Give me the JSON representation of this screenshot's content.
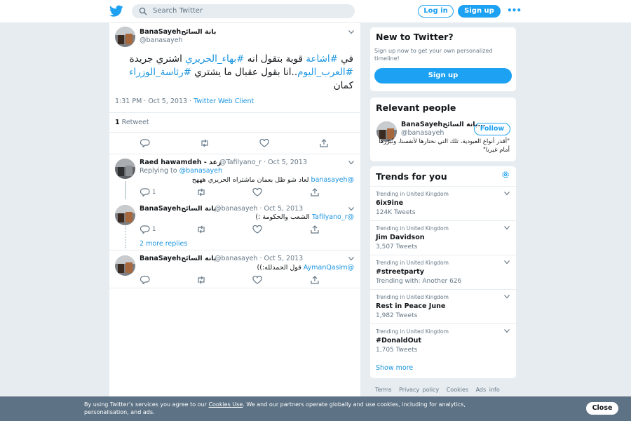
{
  "header": {
    "search_placeholder": "Search Twitter",
    "login_label": "Log in",
    "signup_label": "Sign up",
    "more_label": "•••",
    "brand_color": "#1da1f2"
  },
  "main_tweet": {
    "name": "BanaSayehبانة السائح",
    "handle": "@banasayeh",
    "text_parts": {
      "p1": "في ",
      "h1": "#اشاعة",
      "p2": " قوية بتقول انه ",
      "h2": "#بهاء_الحريري",
      "p3": " اشتري جريدة ",
      "h3": "#العرب_اليوم",
      "p4": "..انا بقول عقبال ما يشتري ",
      "h4": "#رئاسة_الوزراء",
      "p5": " كمان"
    },
    "time": "1:31 PM · Oct 5, 2013",
    "dot": " · ",
    "client": "Twitter Web Client",
    "retweet_count": "1",
    "retweet_label": "Retweet"
  },
  "replies": [
    {
      "name": "Raed hawamdeh - رعد",
      "handle": "@Tafilyano_r · Oct 5, 2013",
      "replying_prefix": "Replying to ",
      "replying_to": "@banasayeh",
      "mention": "@banasayeh",
      "text": " لعاد شو ظل بعمان ماشتراه الحريري هههخ",
      "reply_count": "1"
    },
    {
      "name": "BanaSayehبانة السائح",
      "handle": "@banasayeh · Oct 5, 2013",
      "mention": "@Tafilyano_r",
      "text": " الشعب والحكومة :)",
      "reply_count": "1"
    },
    {
      "more_replies": "2 more replies"
    },
    {
      "name": "BanaSayehبانة السائح",
      "handle": "@banasayeh · Oct 5, 2013",
      "mention": "@AymanQasim",
      "text": " قول الحمدلله:))"
    }
  ],
  "sidebar": {
    "new_to_twitter": {
      "title": "New to Twitter?",
      "subtitle": "Sign up now to get your own personalized timeline!",
      "signup_label": "Sign up"
    },
    "relevant_people": {
      "title": "Relevant people",
      "name": "BanaSayehبانة السائح...",
      "handle": "@banasayeh",
      "follow_label": "Follow",
      "bio": "\"أقذر أنواع العبودية، تلك التي نختارها لأنفسنا، ونُبرّرها أمام غيرنا\""
    },
    "trends": {
      "title": "Trends for you",
      "items": [
        {
          "context": "Trending in United Kingdom",
          "name": "6ix9ine",
          "count": "124K Tweets"
        },
        {
          "context": "Trending in United Kingdom",
          "name": "Jim Davidson",
          "count": "3,507 Tweets"
        },
        {
          "context": "Trending in United Kingdom",
          "name": "#streetparty",
          "count": "Trending with: Another 626"
        },
        {
          "context": "Trending in United Kingdom",
          "name": "Rest in Peace June",
          "count": "1,982 Tweets"
        },
        {
          "context": "Trending in United Kingdom",
          "name": "#DonaldOut",
          "count": "1,705 Tweets"
        }
      ],
      "show_more": "Show more"
    },
    "footer": [
      "Terms",
      "Privacy policy",
      "Cookies",
      "Ads info"
    ]
  },
  "cookie_bar": {
    "text_before": "By using Twitter’s services you agree to our ",
    "link": "Cookies Use",
    "text_after": ". We and our partners operate globally and use cookies, including for analytics, personalisation, and ads.",
    "close_label": "Close"
  }
}
